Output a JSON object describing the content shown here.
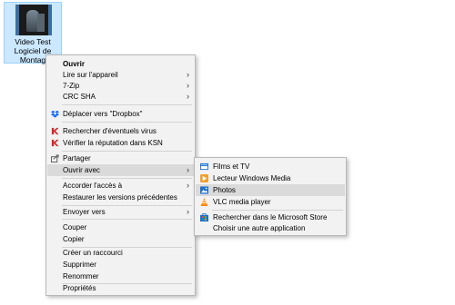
{
  "file": {
    "label_lines": [
      "Video Test",
      "Logiciel de",
      "Montag"
    ]
  },
  "context_menu": {
    "items": [
      {
        "label": "Ouvrir"
      },
      {
        "label": "Lire sur l'appareil"
      },
      {
        "label": "7-Zip"
      },
      {
        "label": "CRC SHA"
      },
      {
        "label": "Déplacer vers \"Dropbox\""
      },
      {
        "label": "Rechercher d'éventuels virus"
      },
      {
        "label": "Vérifier la réputation dans KSN"
      },
      {
        "label": "Partager"
      },
      {
        "label": "Ouvrir avec"
      },
      {
        "label": "Accorder l'accès à"
      },
      {
        "label": "Restaurer les versions précédentes"
      },
      {
        "label": "Envoyer vers"
      },
      {
        "label": "Couper"
      },
      {
        "label": "Copier"
      },
      {
        "label": "Créer un raccourci"
      },
      {
        "label": "Supprimer"
      },
      {
        "label": "Renommer"
      },
      {
        "label": "Propriétés"
      }
    ],
    "submenu_arrow": "›"
  },
  "open_with_submenu": {
    "items": [
      {
        "label": "Films et TV",
        "icon": "films-tv-icon"
      },
      {
        "label": "Lecteur Windows Media",
        "icon": "windows-media-player-icon"
      },
      {
        "label": "Photos",
        "icon": "photos-icon"
      },
      {
        "label": "VLC media player",
        "icon": "vlc-icon"
      },
      {
        "label": "Rechercher dans le Microsoft Store",
        "icon": "microsoft-store-icon"
      },
      {
        "label": "Choisir une autre application"
      }
    ]
  },
  "colors": {
    "selection": "#cce8ff",
    "menu_bg": "#f2f2f2",
    "highlight": "#dadada",
    "kaspersky_red": "#d4272a",
    "dropbox_blue": "#0061fe"
  }
}
